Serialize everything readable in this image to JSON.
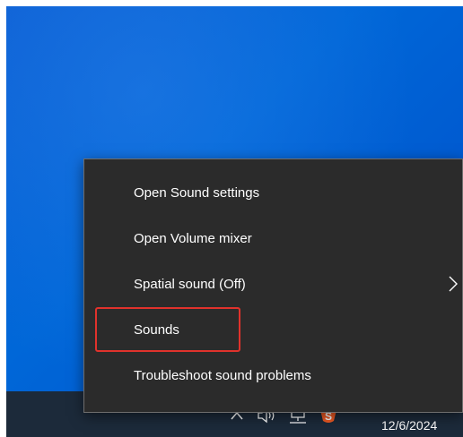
{
  "menu": {
    "items": [
      {
        "label": "Open Sound settings",
        "has_submenu": false
      },
      {
        "label": "Open Volume mixer",
        "has_submenu": false
      },
      {
        "label": "Spatial sound (Off)",
        "has_submenu": true
      },
      {
        "label": "Sounds",
        "has_submenu": false,
        "highlighted": true
      },
      {
        "label": "Troubleshoot sound problems",
        "has_submenu": false
      }
    ]
  },
  "taskbar": {
    "icons": [
      "chevron-up-icon",
      "speaker-icon",
      "network-icon",
      "app-s-icon"
    ],
    "clock_date": "12/6/2024"
  },
  "colors": {
    "desktop": "#0067d8",
    "menu_bg": "#2b2b2b",
    "highlight_border": "#e0322c",
    "taskbar": "#1c2a3a"
  }
}
